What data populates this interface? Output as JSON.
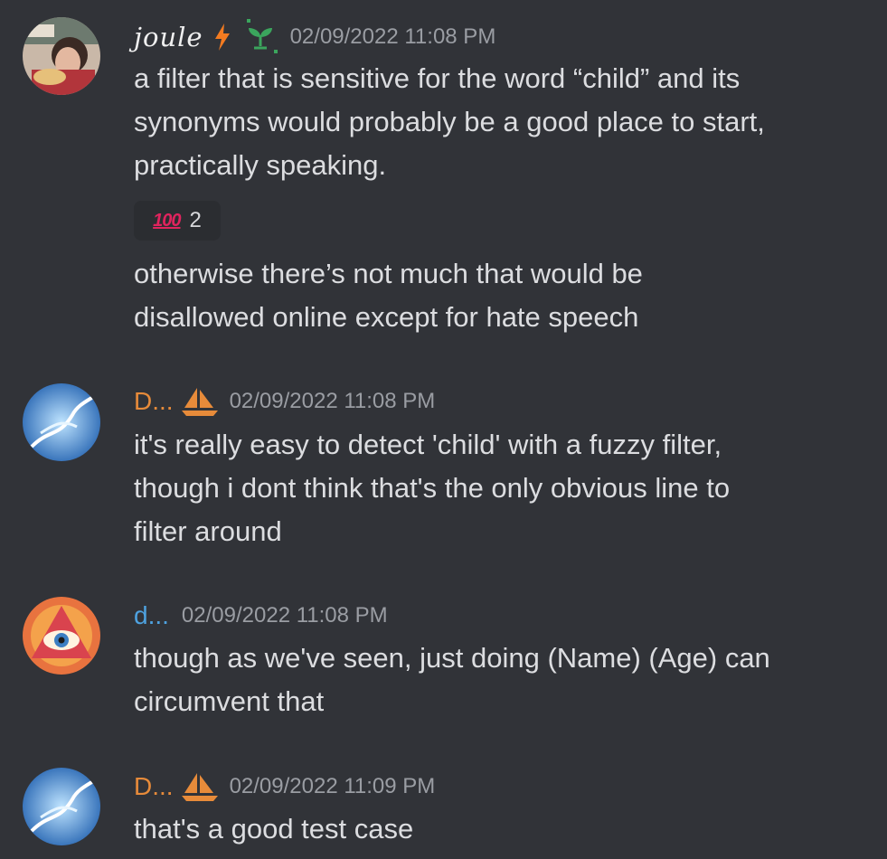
{
  "messages": [
    {
      "username": "joule",
      "timestamp": "02/09/2022 11:08 PM",
      "name_color": "#f0f0f0",
      "badges": [
        "lightning-icon",
        "sprout-icon"
      ],
      "lines": [
        "a filter that is sensitive for the word “child” and its",
        "synonyms would probably be a good place to start,",
        "practically speaking."
      ],
      "reaction": {
        "emoji": "100",
        "emoji_name": "hundred-points-icon",
        "count": "2"
      },
      "followup_lines": [
        "otherwise there’s not much that would be",
        "disallowed online except for hate speech"
      ]
    },
    {
      "username": "D...",
      "timestamp": "02/09/2022 11:08 PM",
      "name_color": "#e78b3a",
      "badges": [
        "sailboat-icon"
      ],
      "lines": [
        "it's really easy to detect 'child' with a fuzzy filter,",
        "though i dont think that's the only obvious line to",
        "filter around"
      ]
    },
    {
      "username": "d...",
      "timestamp": "02/09/2022 11:08 PM",
      "name_color": "#4ea2e0",
      "badges": [],
      "lines": [
        "though as we've seen, just doing (Name) (Age) can",
        "circumvent that"
      ]
    },
    {
      "username": "D...",
      "timestamp": "02/09/2022 11:09 PM",
      "name_color": "#e78b3a",
      "badges": [
        "sailboat-icon"
      ],
      "lines": [
        "that's a good test case"
      ]
    }
  ]
}
